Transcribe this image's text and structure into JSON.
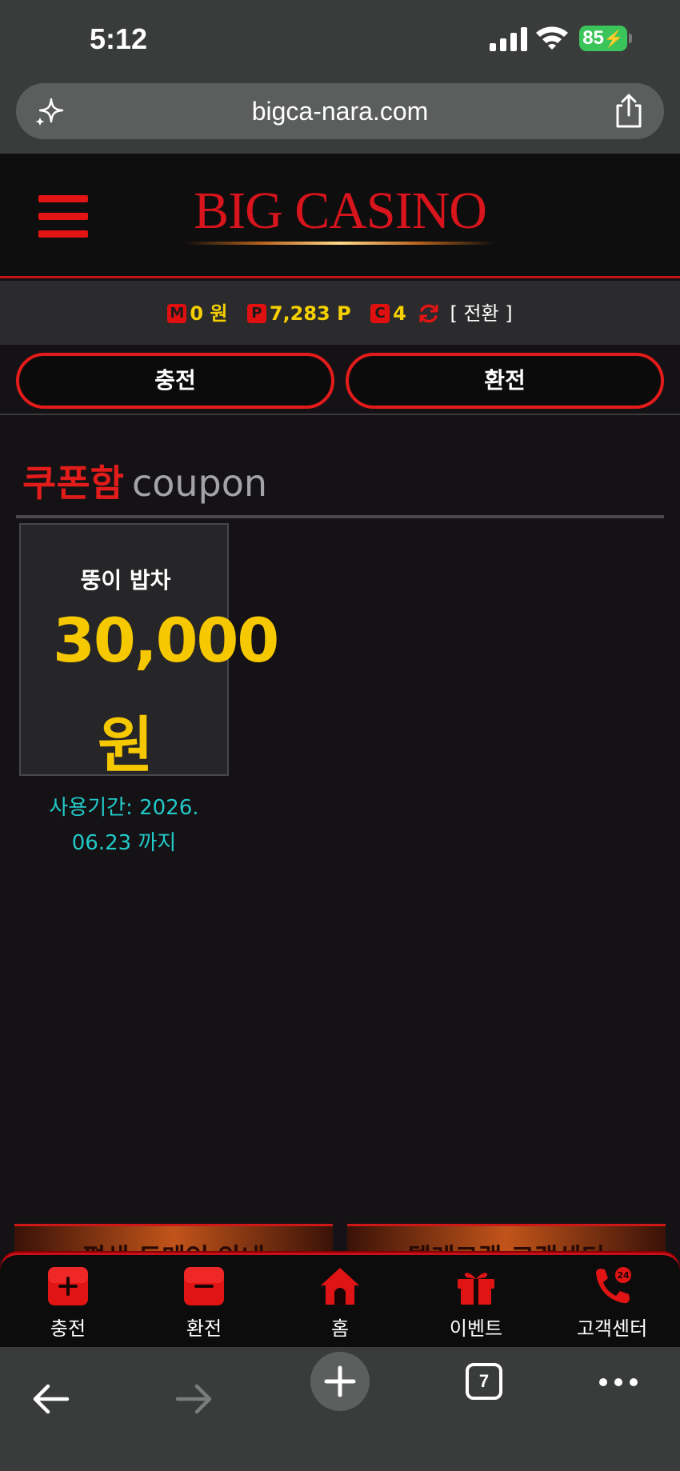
{
  "status_bar": {
    "time": "5:12",
    "battery": "85"
  },
  "browser": {
    "url": "bigca-nara.com",
    "tab_count": "7"
  },
  "site": {
    "logo_text": "BIG CASINO"
  },
  "balance": {
    "money_badge": "M",
    "money_value": "0 원",
    "point_badge": "P",
    "point_value": "7,283 P",
    "coupon_badge": "C",
    "coupon_value": "4",
    "convert_label": "[ 전환 ]"
  },
  "actions": {
    "charge_label": "충전",
    "exchange_label": "환전"
  },
  "coupon_section": {
    "title_kr": "쿠폰함",
    "title_en": "coupon",
    "coupons": [
      {
        "name": "뚱이 밥차",
        "amount": "30,000",
        "unit": "원",
        "expiry": "사용기간: 2026.06.23 까지"
      }
    ]
  },
  "banners": {
    "left_text": "평생 도메인 안내",
    "right_text": "텔레그램 고객센터"
  },
  "bottom_nav": {
    "items": [
      {
        "label": "충전",
        "icon": "plus-icon"
      },
      {
        "label": "환전",
        "icon": "minus-icon"
      },
      {
        "label": "홈",
        "icon": "home-icon"
      },
      {
        "label": "이벤트",
        "icon": "gift-icon"
      },
      {
        "label": "고객센터",
        "icon": "phone-24-icon"
      }
    ]
  },
  "colors": {
    "accent": "#e31414",
    "gold": "#f6c800",
    "cyan": "#22c9c9",
    "background": "#141214"
  }
}
